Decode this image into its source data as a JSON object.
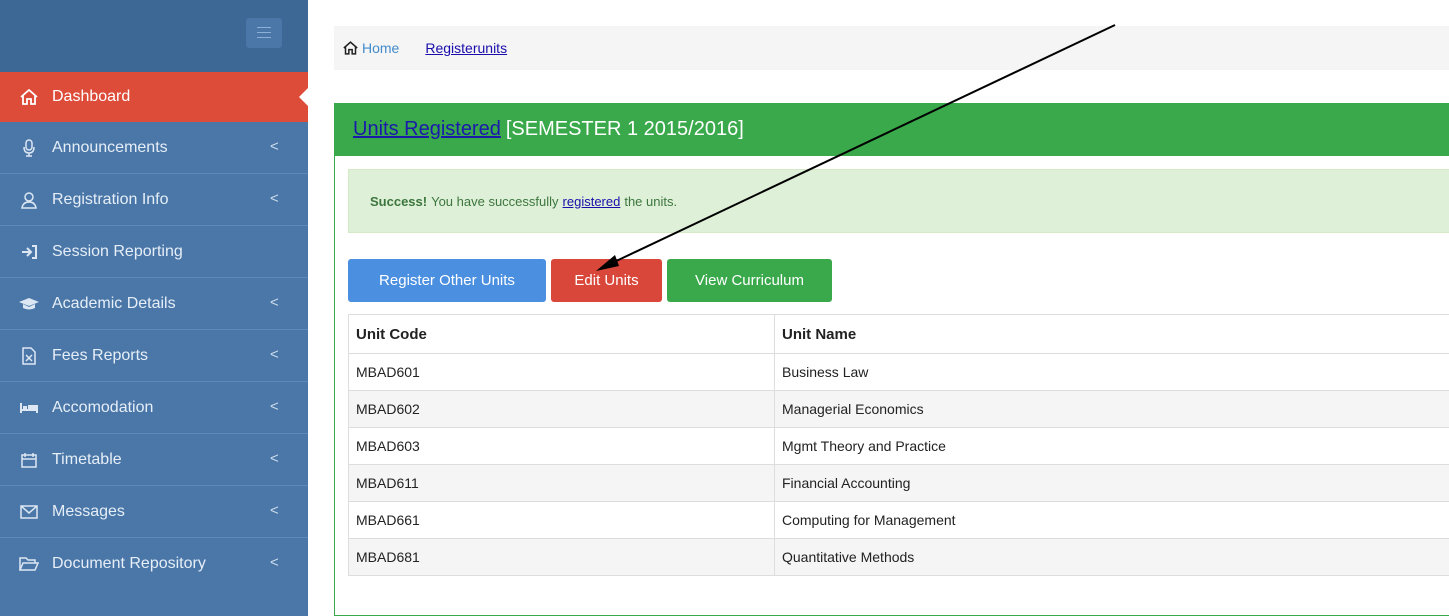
{
  "sidebar": {
    "items": [
      {
        "label": "Dashboard",
        "icon": "home-icon",
        "active": true,
        "chevron": false
      },
      {
        "label": "Announcements",
        "icon": "microphone-icon",
        "active": false,
        "chevron": true
      },
      {
        "label": "Registration Info",
        "icon": "user-icon",
        "active": false,
        "chevron": true
      },
      {
        "label": "Session Reporting",
        "icon": "sign-in-icon",
        "active": false,
        "chevron": false
      },
      {
        "label": "Academic Details",
        "icon": "graduation-cap-icon",
        "active": false,
        "chevron": true
      },
      {
        "label": "Fees Reports",
        "icon": "excel-file-icon",
        "active": false,
        "chevron": true
      },
      {
        "label": "Accomodation",
        "icon": "bed-icon",
        "active": false,
        "chevron": true
      },
      {
        "label": "Timetable",
        "icon": "calendar-icon",
        "active": false,
        "chevron": true
      },
      {
        "label": "Messages",
        "icon": "envelope-icon",
        "active": false,
        "chevron": true
      },
      {
        "label": "Document Repository",
        "icon": "folder-open-icon",
        "active": false,
        "chevron": true
      }
    ],
    "chevron_glyph": "<"
  },
  "breadcrumb": {
    "home": "Home",
    "current": "Registerunits"
  },
  "panel": {
    "title_link": "Units Registered",
    "title_rest": "[SEMESTER 1 2015/2016]"
  },
  "alert": {
    "strong": "Success!",
    "before": "You have successfully",
    "link": "registered",
    "after": "the units."
  },
  "buttons": {
    "register_other": "Register Other Units",
    "edit_units": "Edit Units",
    "view_curriculum": "View Curriculum"
  },
  "table": {
    "headers": [
      "Unit Code",
      "Unit Name"
    ],
    "rows": [
      [
        "MBAD601",
        "Business Law"
      ],
      [
        "MBAD602",
        "Managerial Economics"
      ],
      [
        "MBAD603",
        "Mgmt Theory and Practice"
      ],
      [
        "MBAD611",
        "Financial Accounting"
      ],
      [
        "MBAD661",
        "Computing for Management"
      ],
      [
        "MBAD681",
        "Quantitative Methods"
      ]
    ]
  },
  "colors": {
    "sidebar": "#4a77a8",
    "active": "#dd4b39",
    "success": "#3aa94b",
    "primary": "#4b8fe0",
    "danger": "#d9473a"
  }
}
